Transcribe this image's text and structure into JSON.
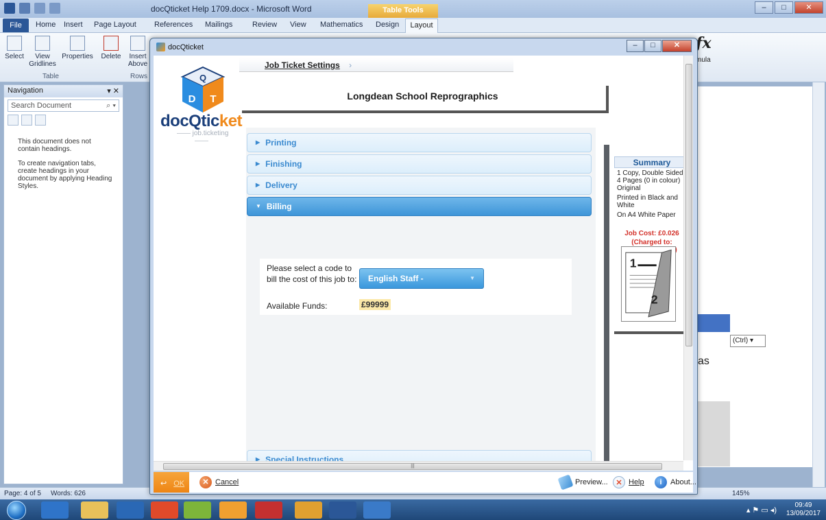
{
  "word": {
    "title": "docQticket Help 1709.docx - Microsoft Word",
    "context_tab": "Table Tools",
    "tabs": [
      "File",
      "Home",
      "Insert",
      "Page Layout",
      "References",
      "Mailings",
      "Review",
      "View",
      "Mathematics",
      "Design",
      "Layout"
    ],
    "ribbon": {
      "select": "Select",
      "view_gridlines": "View Gridlines",
      "properties": "Properties",
      "delete": "Delete",
      "insert_above": "Insert Above",
      "group_table": "Table",
      "group_rows": "Rows",
      "formula": "mula"
    },
    "nav": {
      "title": "Navigation",
      "search_placeholder": "Search Document",
      "msg1": "This document does not contain headings.",
      "msg2": "To create navigation tabs, create headings in your document by applying Heading Styles."
    },
    "doc": {
      "paste_ctrl": "(Ctrl) ▾",
      "text_as": "as"
    },
    "status": {
      "page": "Page: 4 of 5",
      "words": "Words: 626",
      "zoom": "145%"
    }
  },
  "taskbar": {
    "time": "09:49",
    "date": "13/09/2017"
  },
  "dialog": {
    "title": "docQticket",
    "breadcrumb": "Job Ticket Settings",
    "logo_main": "docQtic",
    "logo_tail": "ket",
    "logo_sub": "job.ticketing",
    "school": "Longdean School Reprographics",
    "sections": {
      "printing": "Printing",
      "finishing": "Finishing",
      "delivery": "Delivery",
      "billing": "Billing",
      "special": "Special Instructions"
    },
    "billing": {
      "prompt": "Please select a code to bill the cost of this job to:",
      "selected_code": "English Staff -",
      "funds_label": "Available Funds:",
      "funds_value": "£99999"
    },
    "summary": {
      "title": "Summary",
      "line1": "1 Copy, Double Sided",
      "line2": "4 Pages (0 in colour) Original",
      "line3": "Printed in Black and White",
      "line4": "On A4 White Paper",
      "cost": "Job Cost: £0.026",
      "charged": "(Charged to: English Staff - )"
    },
    "footer": {
      "ok": "OK",
      "cancel": "Cancel",
      "preview": "Preview...",
      "help": "Help",
      "about": "About..."
    }
  }
}
